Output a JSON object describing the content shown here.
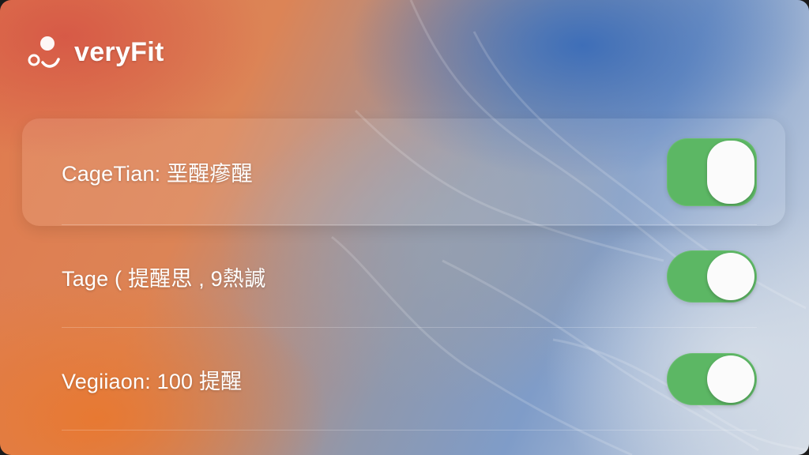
{
  "app": {
    "name": "veryFit",
    "logo_icon": "veryfit-logo-icon"
  },
  "colors": {
    "toggle_on": "#5cb764",
    "knob": "#fbfbfb",
    "text": "#ffffff"
  },
  "settings": [
    {
      "label": "CageTian: 垩醒瘮醒",
      "enabled": true
    },
    {
      "label": "Tage ( 提醒思 , 9熱諴",
      "enabled": true
    },
    {
      "label": "Vegiiaon: 100 提醒",
      "enabled": true
    }
  ]
}
